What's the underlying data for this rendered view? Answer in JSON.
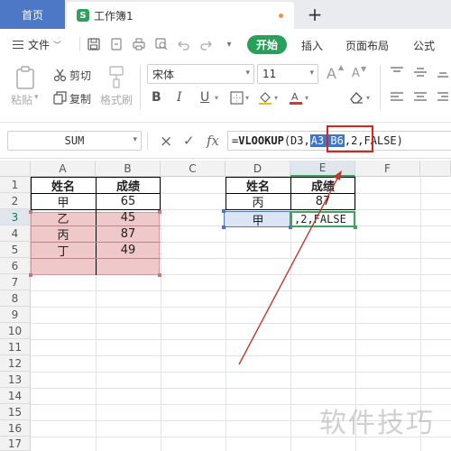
{
  "tabs": {
    "home": "首页",
    "workbook_logo": "S",
    "workbook": "工作簿1",
    "new_tab": "+"
  },
  "menu": {
    "file": "文件",
    "start": "开始",
    "insert": "插入",
    "page_layout": "页面布局",
    "formulas": "公式"
  },
  "ribbon": {
    "paste": "粘贴",
    "cut": "剪切",
    "copy": "复制",
    "format_painter": "格式刷",
    "font_name": "宋体",
    "font_size": "11",
    "grow_font": "A",
    "shrink_font": "A",
    "bold": "B",
    "italic": "I",
    "underline": "U"
  },
  "formula_bar": {
    "name_box": "SUM",
    "cancel": "×",
    "confirm": "✓",
    "fx": "fx",
    "formula_prefix": "=",
    "function_name": "VLOOKUP",
    "arg_open": "(D3,",
    "selected_ref": "A3:B6",
    "formula_rest": ",2,FALSE)"
  },
  "sheet": {
    "columns": [
      "A",
      "B",
      "C",
      "D",
      "E",
      "F"
    ],
    "rows": [
      "1",
      "2",
      "3",
      "4",
      "5",
      "6",
      "7",
      "8",
      "9",
      "10",
      "11",
      "12",
      "13",
      "14",
      "15",
      "16",
      "17"
    ],
    "table1": {
      "header": [
        "姓名",
        "成绩"
      ],
      "rows": [
        [
          "甲",
          "65"
        ],
        [
          "乙",
          "45"
        ],
        [
          "丙",
          "87"
        ],
        [
          "丁",
          "49"
        ]
      ]
    },
    "table2": {
      "header": [
        "姓名",
        "成绩"
      ],
      "row2": [
        "丙",
        "87"
      ],
      "row3_name": "甲",
      "editing_text": ",2,FALSE"
    }
  },
  "watermark": "软件技巧",
  "colors": {
    "accent_green": "#29a05a",
    "tab_blue": "#4d78c6",
    "range_pink": "#efc8ca",
    "annotation_red": "#d9231d",
    "ref_selection_blue": "#3f75c8"
  }
}
